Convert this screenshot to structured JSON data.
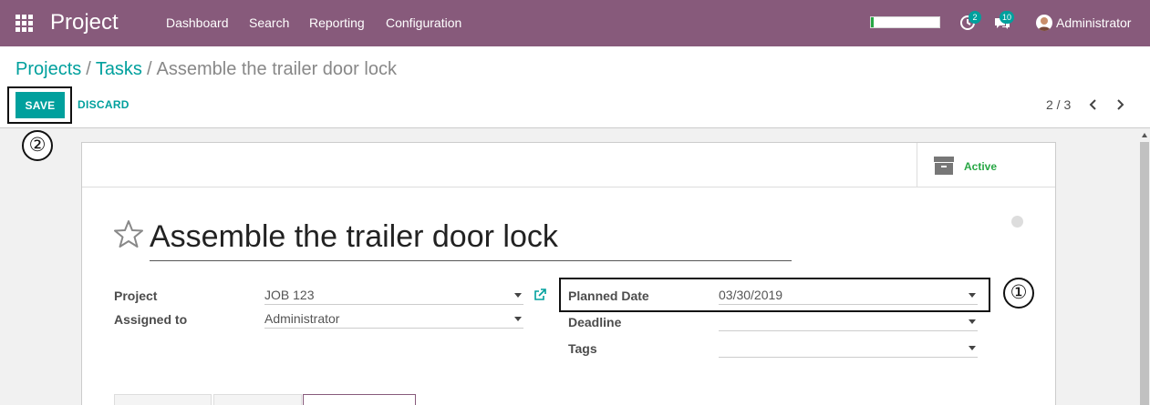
{
  "navbar": {
    "app_title": "Project",
    "menu": [
      "Dashboard",
      "Search",
      "Reporting",
      "Configuration"
    ],
    "progress_fraction": 0.04,
    "activity_count": "2",
    "messages_count": "10",
    "user_name": "Administrator",
    "icons": {
      "apps": "apps-grid-icon",
      "activity": "clock-icon",
      "messages": "chat-bubbles-icon"
    }
  },
  "breadcrumb": {
    "items": [
      "Projects",
      "Tasks"
    ],
    "separator": "/",
    "current": "Assemble the trailer door lock"
  },
  "toolbar": {
    "save_label": "SAVE",
    "discard_label": "DISCARD",
    "pager": "2 / 3"
  },
  "annotations": {
    "one": "①",
    "two": "②"
  },
  "form": {
    "status_label": "Active",
    "task_name": "Assemble the trailer door lock",
    "fields_left": [
      {
        "label": "Project",
        "value": "JOB 123"
      },
      {
        "label": "Assigned to",
        "value": "Administrator"
      }
    ],
    "fields_right": [
      {
        "label": "Planned Date",
        "value": "03/30/2019"
      },
      {
        "label": "Deadline",
        "value": ""
      },
      {
        "label": "Tags",
        "value": ""
      }
    ]
  },
  "colors": {
    "brand": "#875a7b",
    "accent": "#00a09d",
    "active_green": "#28a745"
  }
}
